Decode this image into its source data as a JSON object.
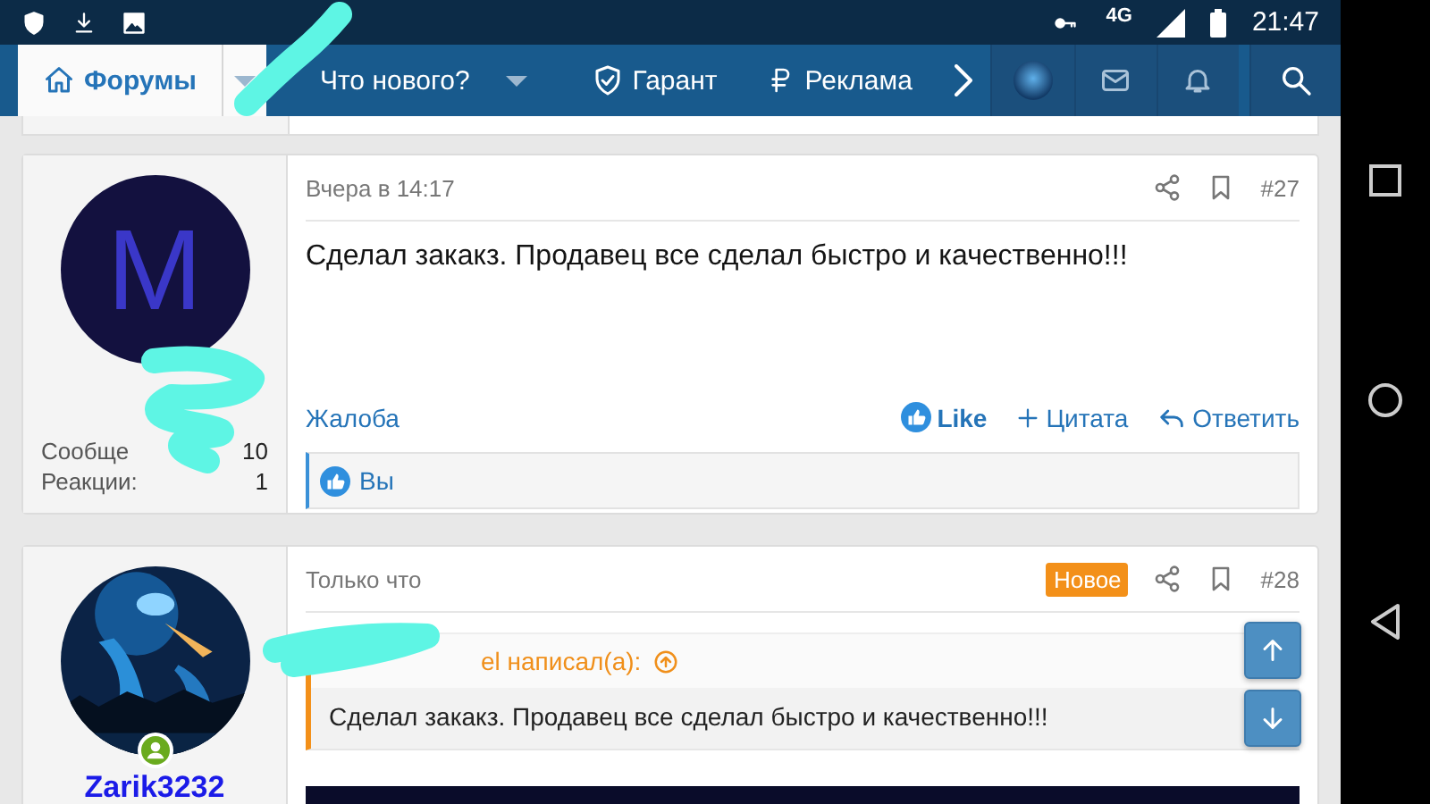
{
  "status_bar": {
    "network": "4G",
    "time": "21:47"
  },
  "nav": {
    "tabs": [
      {
        "label": "Форумы",
        "selected": true,
        "dropdown": true
      },
      {
        "label": "Что нового?",
        "selected": false,
        "dropdown": true
      },
      {
        "label": "Гарант",
        "selected": false,
        "dropdown": false
      },
      {
        "label": "Реклама",
        "selected": false,
        "dropdown": false
      }
    ]
  },
  "posts": [
    {
      "time": "Вчера в 14:17",
      "number": "#27",
      "avatar": {
        "kind": "letter",
        "letter": "M"
      },
      "stats": [
        {
          "label": "Сообще",
          "value": "10"
        },
        {
          "label": "Реакции:",
          "value": "1"
        }
      ],
      "body": "Сделал закакз. Продавец все сделал быстро и качественно!!!",
      "report": "Жалоба",
      "actions": [
        {
          "kind": "like",
          "label": "Like"
        },
        {
          "kind": "quote",
          "label": "Цитата"
        },
        {
          "kind": "reply",
          "label": "Ответить"
        }
      ],
      "reactions": "Вы"
    },
    {
      "time": "Только что",
      "badge": "Новое",
      "number": "#28",
      "avatar": {
        "kind": "picture",
        "online": true
      },
      "username": "Zarik3232",
      "quote": {
        "author": "el написал(а):",
        "text": "Сделал закакз. Продавец все сделал быстро и качественно!!!"
      }
    }
  ]
}
